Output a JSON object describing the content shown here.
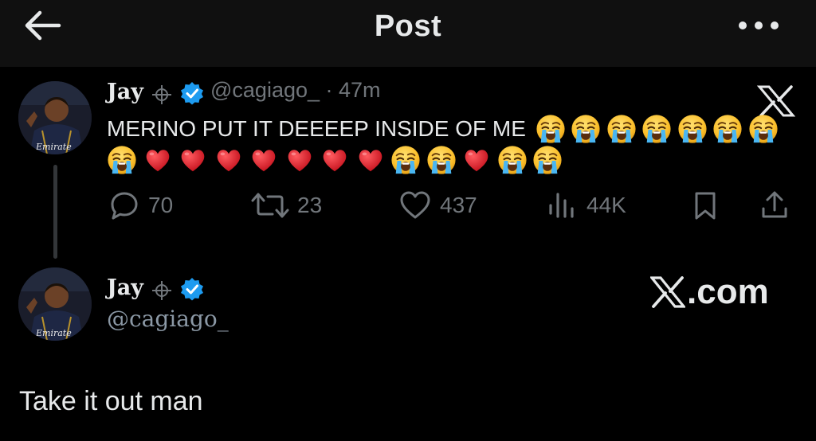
{
  "header": {
    "title": "Post",
    "back_icon": "arrow-left-icon",
    "more_icon": "more-horizontal-icon"
  },
  "original_post": {
    "display_name": "Jay",
    "name_icons": [
      "crosshair-icon",
      "verified-badge-icon"
    ],
    "handle_time": "@cagiago_ · 47m",
    "text": "MERINO PUT IT DEEEEP INSIDE OF ME",
    "emoji_line_1": [
      "😭",
      "😭",
      "😭",
      "😭",
      "😭",
      "😭",
      "😭"
    ],
    "emoji_line_2": [
      "😭",
      "❤️",
      "❤️",
      "❤️",
      "❤️",
      "❤️",
      "❤️",
      "❤️",
      "😭",
      "😭",
      "❤️",
      "😭",
      "😭"
    ],
    "actions": {
      "replies": "70",
      "reposts": "23",
      "likes": "437",
      "views": "44K"
    },
    "watermark_icon": "x-logo-icon"
  },
  "quoted_reply": {
    "display_name": "Jay",
    "handle": "@cagiago_",
    "watermark": "X.com",
    "text": "Take it out man"
  },
  "colors": {
    "background": "#000000",
    "header_background": "#101010",
    "text_primary": "#e7e9ea",
    "text_secondary": "#71767b",
    "verified_blue": "#1d9bf0",
    "heart_red": "#e0202e"
  }
}
